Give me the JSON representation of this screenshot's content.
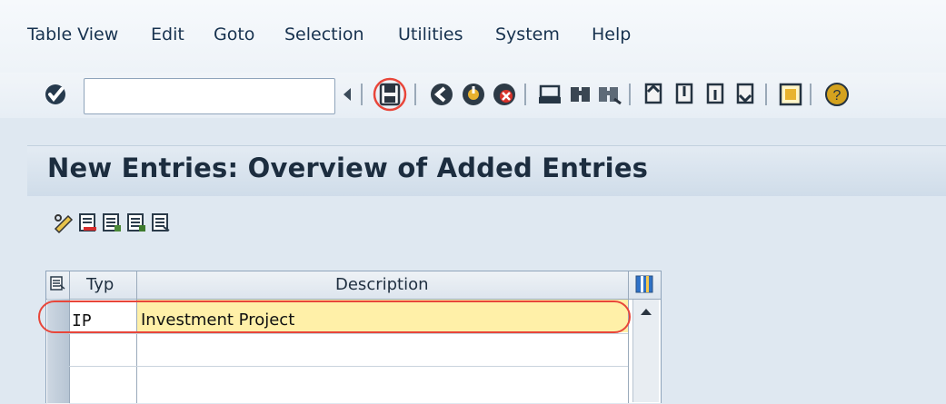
{
  "menu": [
    "Table View",
    "Edit",
    "Goto",
    "Selection",
    "Utilities",
    "System",
    "Help"
  ],
  "toolbar": {
    "command_field_value": "",
    "icons": [
      "enter-check-icon",
      "back-triangle-icon",
      "save-icon",
      "back-icon",
      "exit-icon",
      "cancel-icon",
      "print-icon",
      "find-icon",
      "find-next-icon",
      "first-page-icon",
      "previous-page-icon",
      "next-page-icon",
      "last-page-icon",
      "layout-icon",
      "help-icon"
    ]
  },
  "title": "New Entries: Overview of Added Entries",
  "app_toolbar_icons": [
    "change-display-icon",
    "delete-row-icon",
    "select-all-icon",
    "deselect-icon",
    "select-block-icon"
  ],
  "table": {
    "columns": [
      "Typ",
      "Description"
    ],
    "rows": [
      {
        "typ": "IP",
        "description": "Investment Project"
      },
      {
        "typ": "",
        "description": ""
      },
      {
        "typ": "",
        "description": ""
      }
    ]
  },
  "colors": {
    "highlight": "#e8463a",
    "selected_row": "#fff0a8"
  }
}
